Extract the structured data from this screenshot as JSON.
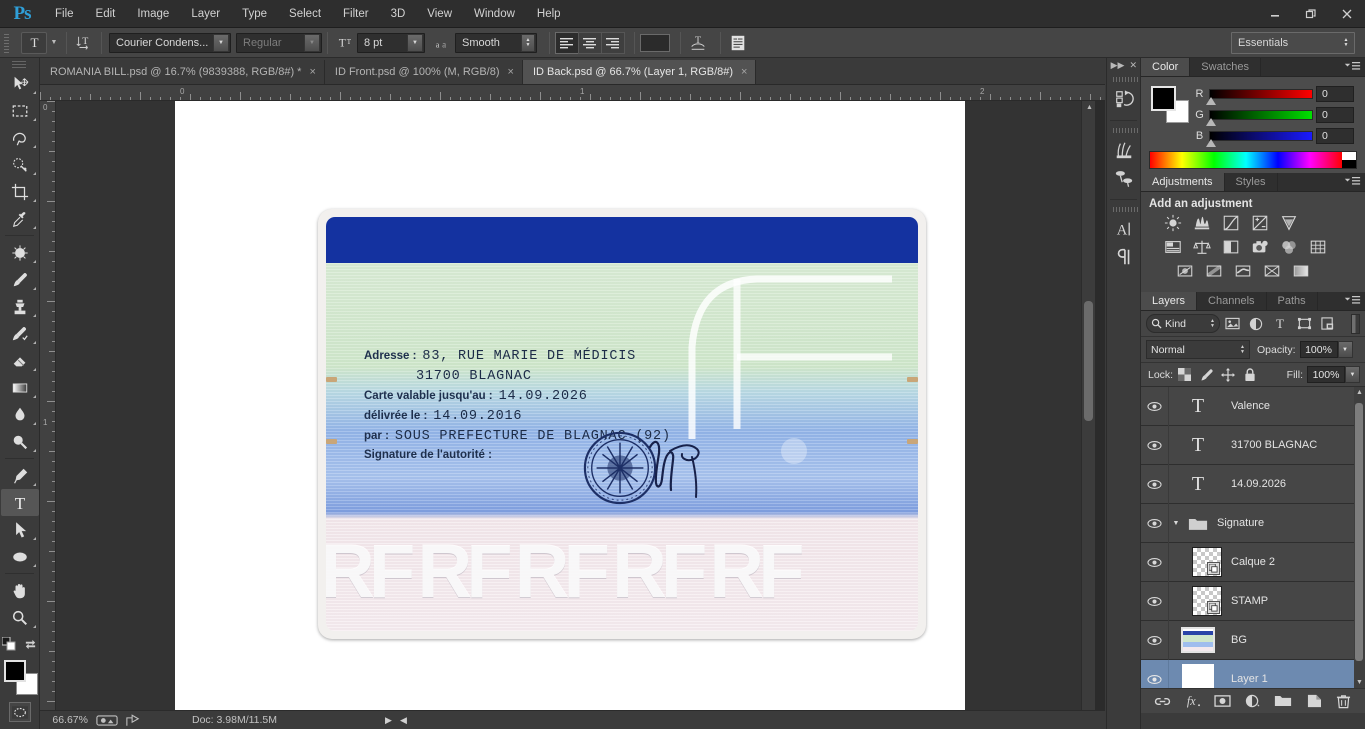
{
  "app": {
    "name": "Ps",
    "logo_color": "#2f9fd8"
  },
  "menubar": {
    "items": [
      "File",
      "Edit",
      "Image",
      "Layer",
      "Type",
      "Select",
      "Filter",
      "3D",
      "View",
      "Window",
      "Help"
    ]
  },
  "window_controls": {
    "minimize": "minimize-icon",
    "restore": "restore-icon",
    "close": "close-icon"
  },
  "options_bar": {
    "tool_icon": "text-tool-icon",
    "orientation_icon": "text-orientation-icon",
    "font_family": "Courier Condens...",
    "font_style": "Regular",
    "font_size": "8 pt",
    "anti_alias_icon": "anti-alias-icon",
    "anti_alias": "Smooth",
    "align": [
      "align-left-icon",
      "align-center-icon",
      "align-right-icon"
    ],
    "align_selected": 0,
    "text_color": "#2b2b2b",
    "warp_icon": "warp-text-icon",
    "panel_icon": "character-panel-icon",
    "workspace": "Essentials"
  },
  "tabs": [
    {
      "label": "ROMANIA BILL.psd @ 16.7% (9839388, RGB/8#) *",
      "active": false,
      "close": "×"
    },
    {
      "label": "ID Front.psd @ 100% (M, RGB/8)",
      "active": false,
      "close": "×"
    },
    {
      "label": "ID Back.psd @ 66.7% (Layer 1, RGB/8#)",
      "active": true,
      "close": "×"
    }
  ],
  "toolbox": {
    "groups": [
      [
        "move-tool",
        "rectangular-marquee-tool",
        "lasso-tool",
        "quick-selection-tool",
        "crop-tool",
        "eyedropper-tool"
      ],
      [
        "spot-healing-brush-tool",
        "brush-tool",
        "clone-stamp-tool",
        "history-brush-tool",
        "eraser-tool",
        "gradient-tool",
        "blur-tool",
        "dodge-tool"
      ],
      [
        "pen-tool",
        "type-tool",
        "path-selection-tool",
        "ellipse-shape-tool"
      ],
      [
        "hand-tool",
        "zoom-tool"
      ]
    ],
    "active_tool": "type-tool",
    "foreground_color": "#000000",
    "background_color": "#ffffff",
    "quick_mask": "quick-mask-icon"
  },
  "rulers": {
    "h_labels": [
      "0",
      "1",
      "2"
    ],
    "v_labels": [
      "0",
      "1"
    ],
    "unit": "in"
  },
  "canvas": {
    "card": {
      "header_color": "#1432a0",
      "watermark_text": "RF",
      "watermark_repeats": 5,
      "lines": [
        {
          "label": "Adresse :",
          "value": "83, RUE MARIE DE MÉDICIS"
        },
        {
          "label": "",
          "value": "31700 BLAGNAC"
        },
        {
          "label": "Carte valable jusqu'au :",
          "value": "14.09.2026"
        },
        {
          "label": "délivrée le :",
          "value": "14.09.2016"
        },
        {
          "label": "par :",
          "value": "SOUS PREFECTURE DE BLAGNAC (92)"
        },
        {
          "label": "Signature de l'autorité :",
          "value": ""
        }
      ],
      "stamp": "official-stamp",
      "signature": "handwritten-signature"
    }
  },
  "status_bar": {
    "zoom": "66.67%",
    "doc_label": "Doc:",
    "doc_size": "3.98M/11.5M",
    "arrow_icon": "play-arrow-icon"
  },
  "rail": {
    "collapse_icon": "collapse-to-icons-icon",
    "close_icon": "close-icon",
    "buttons": [
      "history-icon",
      "brush-presets-icon",
      "clone-source-icon",
      "character-icon",
      "paragraph-icon"
    ]
  },
  "color_panel": {
    "tabs": [
      "Color",
      "Swatches"
    ],
    "active_tab": "Color",
    "menu_icon": "panel-menu-icon",
    "foreground": "#000000",
    "background": "#ffffff",
    "channels": [
      {
        "label": "R",
        "value": "0",
        "ramp_from": "#000000",
        "ramp_to": "#ff0000"
      },
      {
        "label": "G",
        "value": "0",
        "ramp_from": "#000000",
        "ramp_to": "#00ff00"
      },
      {
        "label": "B",
        "value": "0",
        "ramp_from": "#000000",
        "ramp_to": "#0000ff"
      }
    ]
  },
  "adjustments_panel": {
    "tabs": [
      "Adjustments",
      "Styles"
    ],
    "active_tab": "Adjustments",
    "menu_icon": "panel-menu-icon",
    "title": "Add an adjustment",
    "row1": [
      "brightness-contrast-icon",
      "levels-icon",
      "curves-icon",
      "exposure-icon",
      "vibrance-icon"
    ],
    "row2": [
      "hue-saturation-icon",
      "color-balance-icon",
      "black-white-icon",
      "photo-filter-icon",
      "channel-mixer-icon",
      "color-lookup-icon"
    ],
    "row3": [
      "invert-icon",
      "posterize-icon",
      "threshold-icon",
      "selective-color-icon",
      "gradient-map-icon"
    ]
  },
  "layers_panel": {
    "tabs": [
      "Layers",
      "Channels",
      "Paths"
    ],
    "active_tab": "Layers",
    "menu_icon": "panel-menu-icon",
    "filter_kind": "Kind",
    "filter_icons": [
      "pixel-filter-icon",
      "adjustment-filter-icon",
      "type-filter-icon",
      "shape-filter-icon",
      "smart-object-filter-icon"
    ],
    "blend_mode": "Normal",
    "opacity_label": "Opacity:",
    "opacity_value": "100%",
    "lock_label": "Lock:",
    "lock_icons": [
      "lock-transparency-icon",
      "lock-image-icon",
      "lock-position-icon",
      "lock-all-icon"
    ],
    "fill_label": "Fill:",
    "fill_value": "100%",
    "layers": [
      {
        "name": "Valence",
        "type": "text",
        "visible": true,
        "selected": false,
        "indent": 0
      },
      {
        "name": "31700 BLAGNAC",
        "type": "text",
        "visible": true,
        "selected": false,
        "indent": 0
      },
      {
        "name": "14.09.2026",
        "type": "text",
        "visible": true,
        "selected": false,
        "indent": 0
      },
      {
        "name": "Signature",
        "type": "group",
        "visible": true,
        "selected": false,
        "indent": 0,
        "expanded": true
      },
      {
        "name": "Calque 2",
        "type": "raster",
        "visible": true,
        "selected": false,
        "indent": 1,
        "has_fx": true
      },
      {
        "name": "STAMP",
        "type": "raster",
        "visible": true,
        "selected": false,
        "indent": 1,
        "has_fx": true
      },
      {
        "name": "BG",
        "type": "image",
        "visible": true,
        "selected": false,
        "indent": 0
      },
      {
        "name": "Layer 1",
        "type": "blank",
        "visible": true,
        "selected": true,
        "indent": 0
      }
    ],
    "footer_icons": [
      "link-layers-icon",
      "add-layer-style-icon",
      "add-layer-mask-icon",
      "new-fill-adjustment-icon",
      "new-group-icon",
      "new-layer-icon",
      "delete-layer-icon"
    ]
  }
}
